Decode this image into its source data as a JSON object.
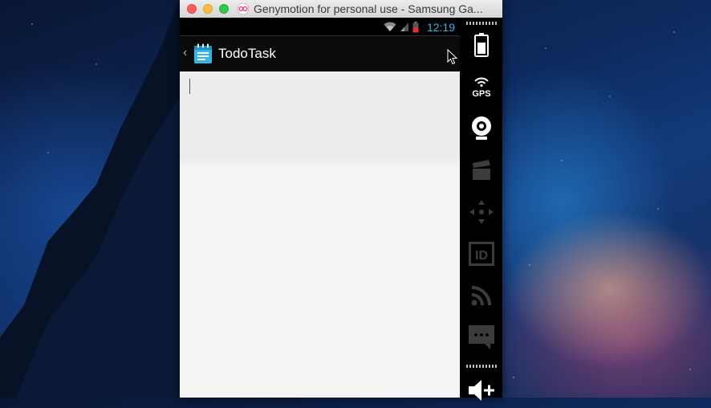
{
  "window": {
    "title": "Genymotion for personal use - Samsung Ga..."
  },
  "statusbar": {
    "time": "12:19",
    "icons": [
      "wifi-icon",
      "signal-icon",
      "battery-icon"
    ]
  },
  "actionbar": {
    "title": "TodoTask",
    "app_icon": "notepad-icon"
  },
  "editor": {
    "value": ""
  },
  "sidebar": {
    "buttons": [
      {
        "name": "battery-widget",
        "icon": "battery-icon",
        "enabled": true
      },
      {
        "name": "gps-widget",
        "icon": "gps-icon",
        "label": "GPS",
        "enabled": true
      },
      {
        "name": "camera-widget",
        "icon": "webcam-icon",
        "enabled": true
      },
      {
        "name": "screencast-widget",
        "icon": "clapperboard-icon",
        "enabled": false
      },
      {
        "name": "remote-control-widget",
        "icon": "dpad-icon",
        "enabled": false
      },
      {
        "name": "device-id-widget",
        "icon": "id-icon",
        "label": "ID",
        "enabled": false
      },
      {
        "name": "network-widget",
        "icon": "rss-icon",
        "enabled": false
      },
      {
        "name": "sms-widget",
        "icon": "message-icon",
        "enabled": false
      },
      {
        "name": "volume-up-widget",
        "icon": "volume-up-icon",
        "enabled": true
      }
    ]
  },
  "colors": {
    "clock": "#33b5e5",
    "app_icon": "#33b5e5",
    "disabled_icon": "#3c3c3c"
  }
}
